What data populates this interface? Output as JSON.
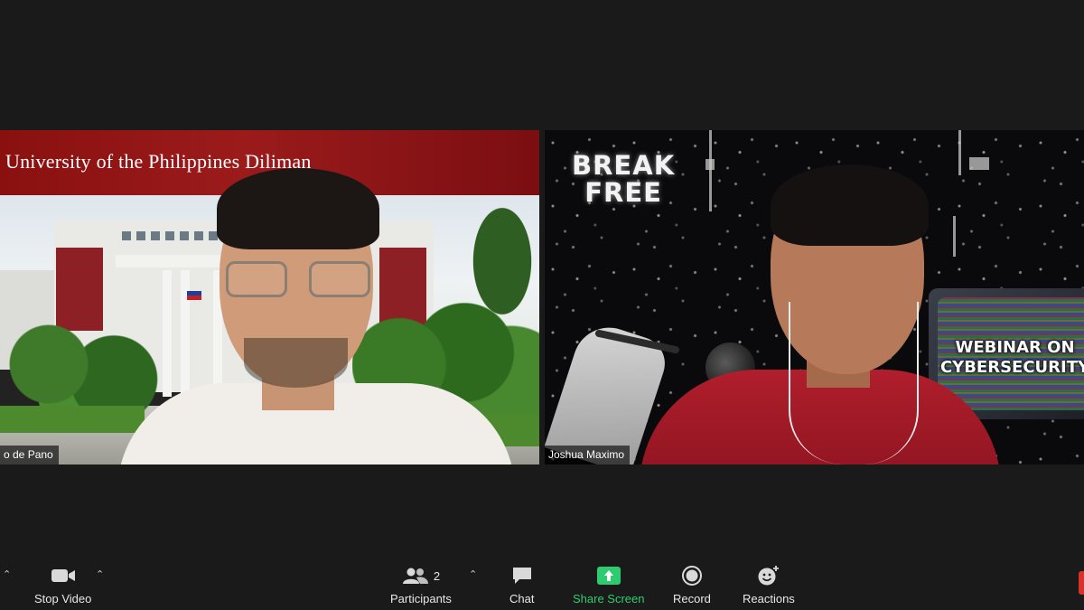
{
  "participants_view": {
    "left_tile": {
      "name_tag": "o de Pano",
      "background_banner": "University of the Philippines Diliman"
    },
    "right_tile": {
      "name_tag": "Joshua Maximo",
      "background_text_top_line1": "BREAK",
      "background_text_top_line2": "FREE",
      "background_text_tv_line1": "WEBINAR ON",
      "background_text_tv_line2": "CYBERSECURITY"
    }
  },
  "toolbar": {
    "stop_video": {
      "label": "Stop Video",
      "icon": "video-camera-icon"
    },
    "participants": {
      "label": "Participants",
      "count": "2",
      "icon": "participants-icon"
    },
    "chat": {
      "label": "Chat",
      "icon": "chat-bubble-icon"
    },
    "share_screen": {
      "label": "Share Screen",
      "icon": "share-screen-arrow-icon"
    },
    "record": {
      "label": "Record",
      "icon": "record-icon"
    },
    "reactions": {
      "label": "Reactions",
      "icon": "emoji-plus-icon"
    }
  },
  "colors": {
    "background": "#1a1a1a",
    "share_screen_green": "#2ecc71",
    "label_text": "#e8e8e8"
  }
}
